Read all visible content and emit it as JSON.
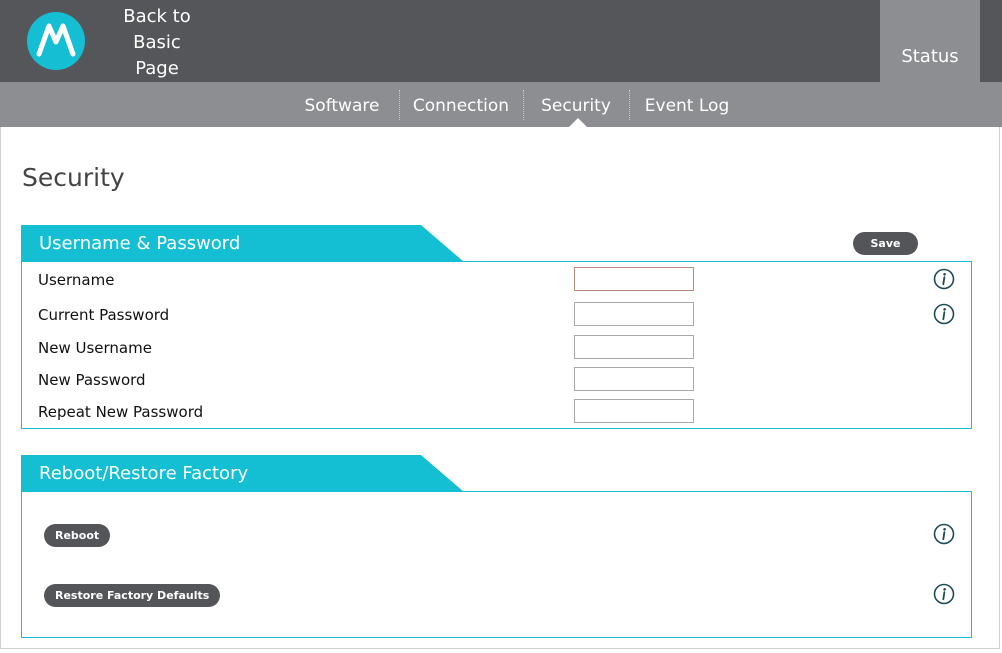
{
  "header": {
    "logo_icon": "motorola-logo-icon",
    "back_link": [
      "Back to",
      "Basic",
      "Page"
    ],
    "status_tab": "Status"
  },
  "subnav": {
    "items": [
      "Software",
      "Connection",
      "Security",
      "Event Log"
    ],
    "active": "Security"
  },
  "page": {
    "title": "Security"
  },
  "credentials_panel": {
    "title": "Username & Password",
    "save_label": "Save",
    "fields": [
      {
        "label": "Username",
        "value": "",
        "has_info": true
      },
      {
        "label": "Current Password",
        "value": "",
        "has_info": true
      },
      {
        "label": "New Username",
        "value": "",
        "has_info": false
      },
      {
        "label": "New Password",
        "value": "",
        "has_info": false
      },
      {
        "label": "Repeat New Password",
        "value": "",
        "has_info": false
      }
    ]
  },
  "reboot_panel": {
    "title": "Reboot/Restore Factory",
    "reboot_label": "Reboot",
    "restore_label": "Restore Factory Defaults"
  },
  "colors": {
    "header_dark": "#55565a",
    "header_light": "#8d8e91",
    "accent": "#14bfd4",
    "button": "#545559",
    "info_icon": "#1d4a5c"
  }
}
